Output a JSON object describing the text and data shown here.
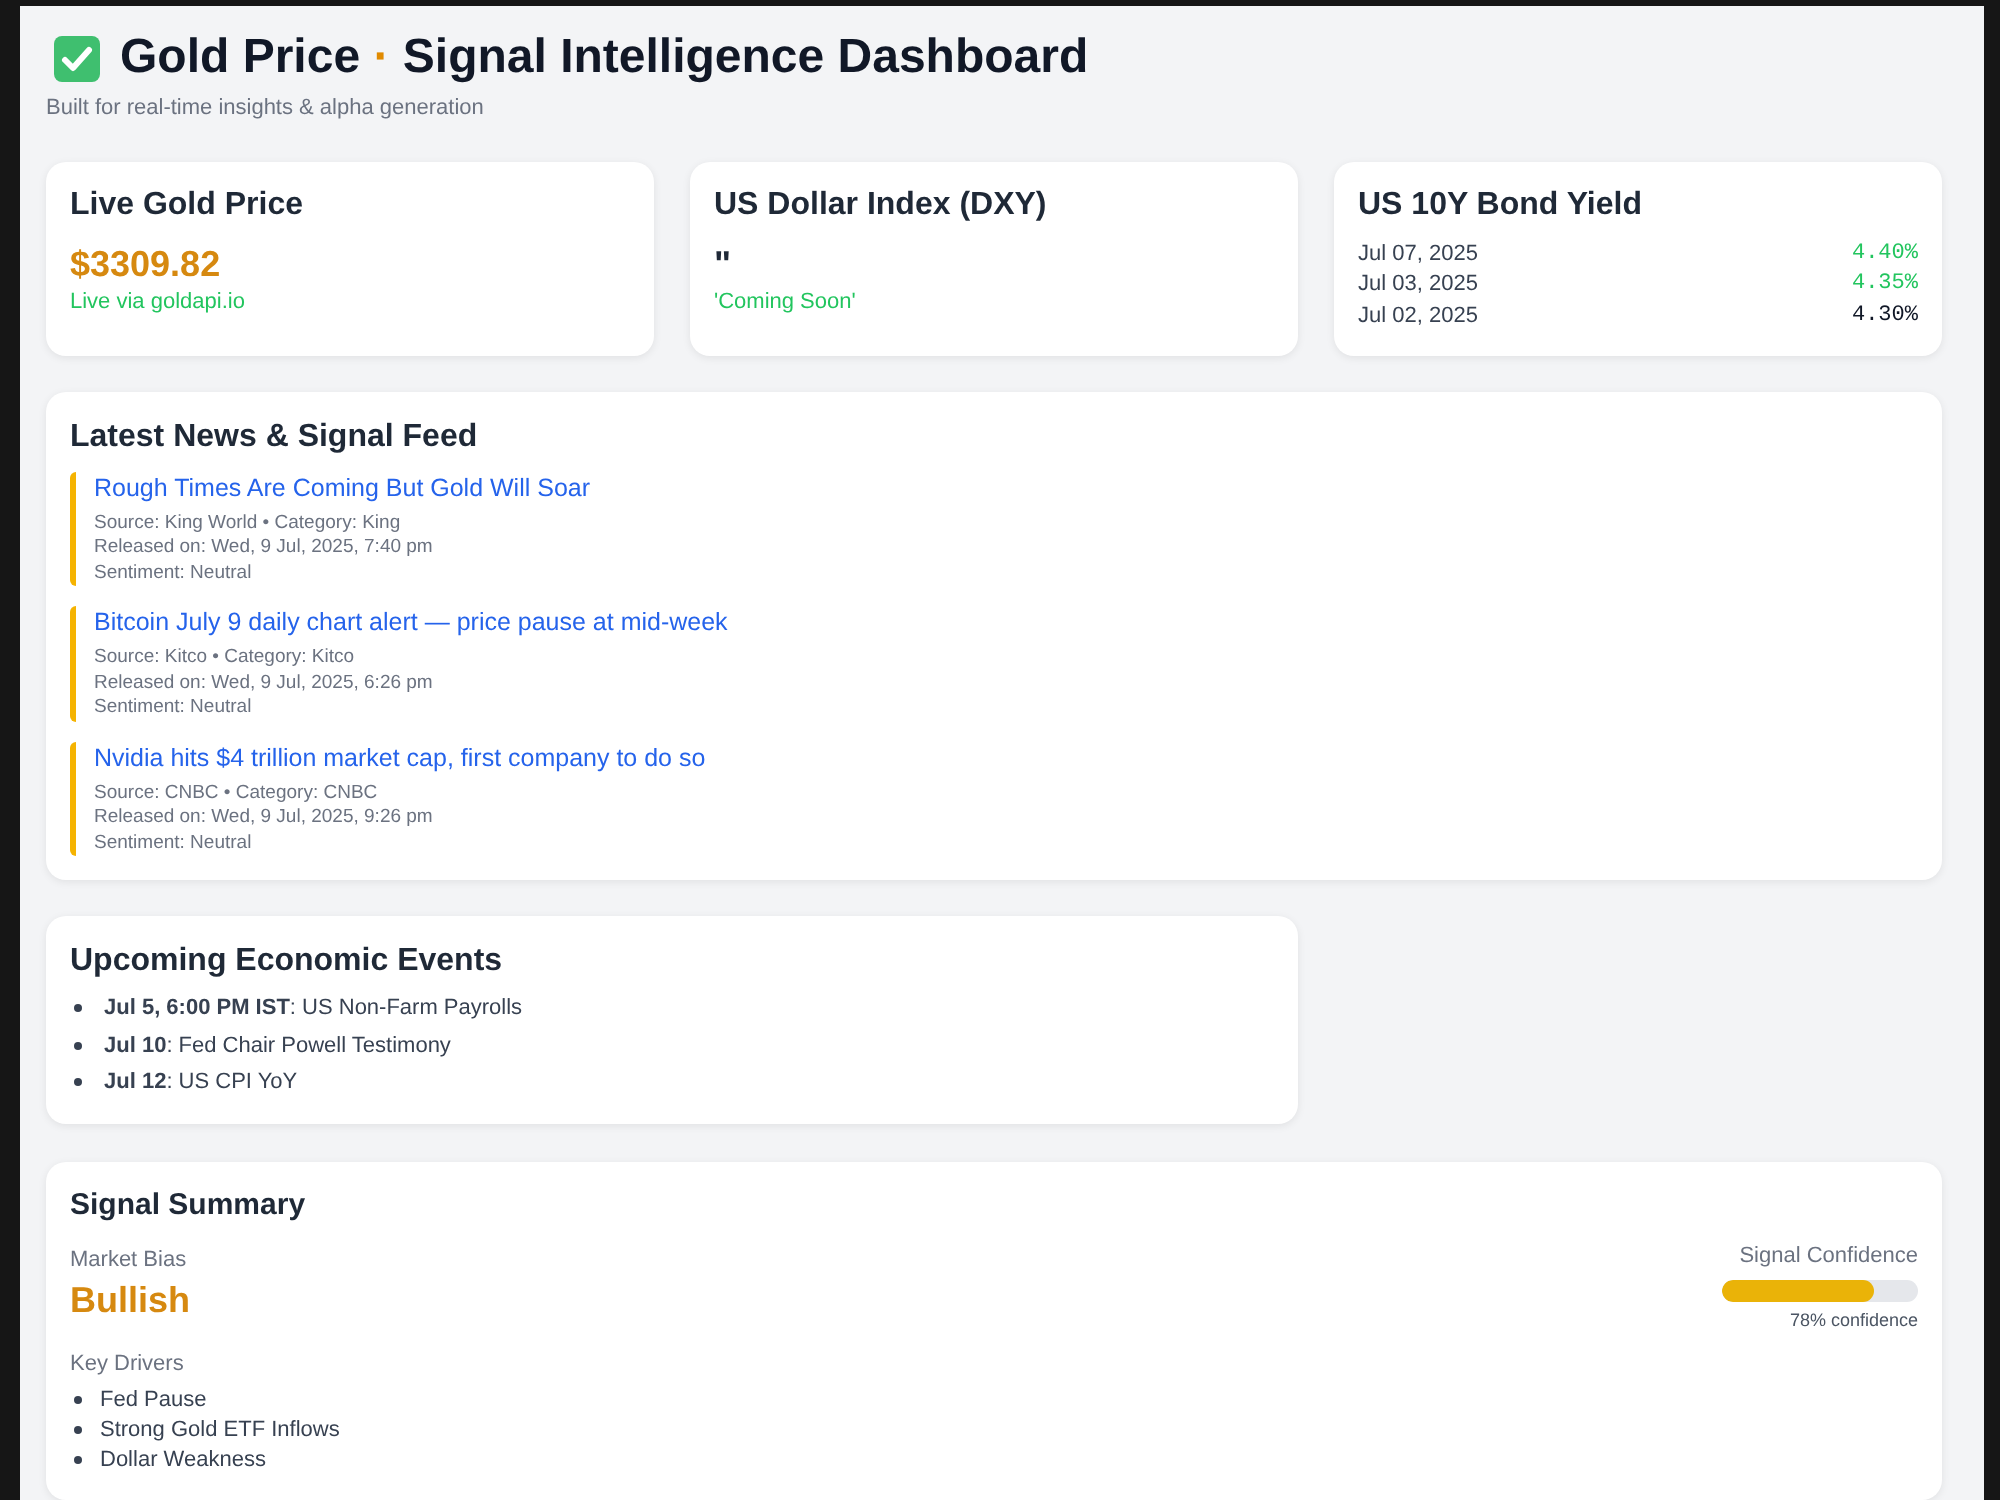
{
  "header": {
    "title": {
      "lead": "Gold Price",
      "separator": "·",
      "rest": "Signal Intelligence Dashboard"
    },
    "subtitle": "Built for real-time insights & alpha generation"
  },
  "metrics": [
    {
      "kind": "price",
      "title": "Live Gold Price",
      "value": "$3309.82",
      "note": "Live via goldapi.io"
    },
    {
      "kind": "pending",
      "title": "US Dollar Index (DXY)",
      "value": "\"",
      "note": "'Coming Soon'"
    },
    {
      "kind": "yields",
      "title": "US 10Y Bond Yield",
      "rows": [
        {
          "date": "Jul 07, 2025",
          "value": "4.40%",
          "color": "#22c55e"
        },
        {
          "date": "Jul 03, 2025",
          "value": "4.35%",
          "color": "#22c55e"
        },
        {
          "date": "Jul 02, 2025",
          "value": "4.30%",
          "color": "#111827"
        }
      ]
    }
  ],
  "news": {
    "title": "Latest News & Signal Feed",
    "items": [
      {
        "headline": "Rough Times Are Coming But Gold Will Soar",
        "source": "Source: King World • Category: King",
        "released": "Released on: Wed, 9 Jul, 2025, 7:40 pm",
        "sentiment": "Sentiment: Neutral"
      },
      {
        "headline": "Bitcoin July 9 daily chart alert — price pause at mid-week",
        "source": "Source: Kitco • Category: Kitco",
        "released": "Released on: Wed, 9 Jul, 2025, 6:26 pm",
        "sentiment": "Sentiment: Neutral"
      },
      {
        "headline": "Nvidia hits $4 trillion market cap, first company to do so",
        "source": "Source: CNBC • Category: CNBC",
        "released": "Released on: Wed, 9 Jul, 2025, 9:26 pm",
        "sentiment": "Sentiment: Neutral"
      }
    ]
  },
  "events": {
    "title": "Upcoming Economic Events",
    "items": [
      "**Jul 5, 6:00 PM IST**: US Non-Farm Payrolls",
      "**Jul 10**: Fed Chair Powell Testimony",
      "**Jul 12**: US CPI YoY"
    ]
  },
  "summary": {
    "title": "Signal Summary",
    "bias_label": "Market Bias",
    "bias": "Bullish",
    "drivers_label": "Key Drivers",
    "drivers": [
      "Fed Pause",
      "Strong Gold ETF Inflows",
      "Dollar Weakness"
    ],
    "confidence_label": "Signal Confidence",
    "level": 0.78,
    "confidence_text": "78% confidence"
  }
}
